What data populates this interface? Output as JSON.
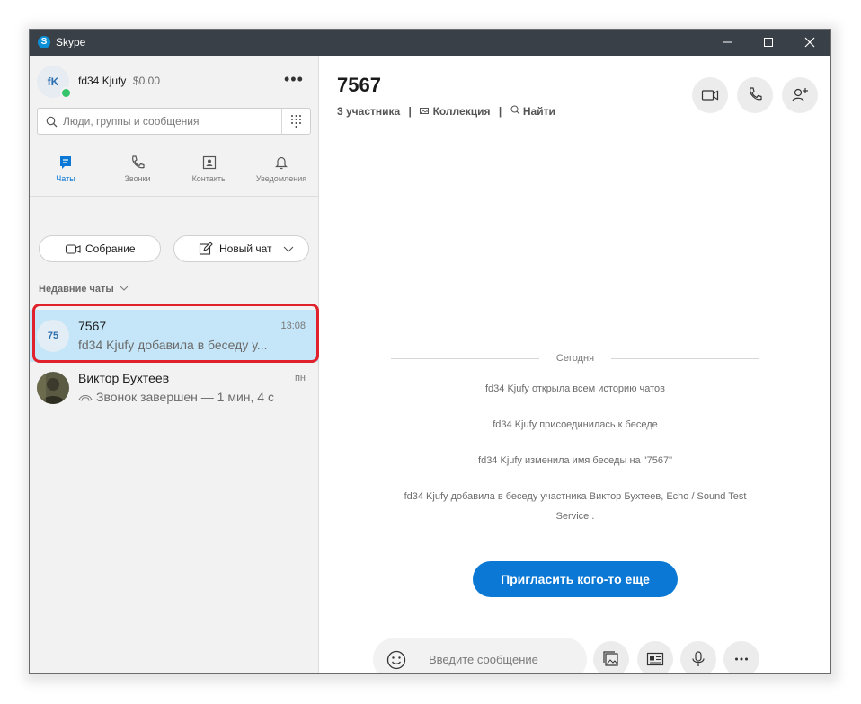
{
  "window": {
    "title": "Skype",
    "logo_letter": "S"
  },
  "profile": {
    "initials": "fK",
    "name": "fd34 Kjufy",
    "balance": "$0.00",
    "more": "•••"
  },
  "search": {
    "placeholder": "Люди, группы и сообщения"
  },
  "nav": [
    {
      "label": "Чаты",
      "icon": "chat-icon",
      "active": true
    },
    {
      "label": "Звонки",
      "icon": "phone-icon",
      "active": false
    },
    {
      "label": "Контакты",
      "icon": "contacts-icon",
      "active": false
    },
    {
      "label": "Уведомления",
      "icon": "bell-icon",
      "active": false
    }
  ],
  "actions": {
    "meeting": "Собрание",
    "new_chat": "Новый чат"
  },
  "recent": {
    "title": "Недавние чаты",
    "items": [
      {
        "initials": "75",
        "name": "7567",
        "time": "13:08",
        "preview": "fd34 Kjufy добавила в беседу у...",
        "active": true
      },
      {
        "name": "Виктор Бухтеев",
        "time": "пн",
        "preview": "Звонок завершен — 1 мин, 4 с",
        "active": false
      }
    ]
  },
  "conversation": {
    "title": "7567",
    "participants": "3 участника",
    "gallery": "Коллекция",
    "find": "Найти",
    "day": "Сегодня",
    "messages": [
      "fd34 Kjufy открыла всем историю чатов",
      "fd34 Kjufy присоединилась к беседе",
      "fd34 Kjufy изменила имя беседы на \"7567\"",
      "fd34 Kjufy добавила в беседу участника Виктор Бухтеев, Echo / Sound Test Service ."
    ],
    "invite": "Пригласить кого-то еще"
  },
  "composer": {
    "placeholder": "Введите сообщение"
  },
  "colors": {
    "accent": "#0a78d4",
    "titlebar": "#3a4048",
    "highlight": "#e0202a",
    "selected": "#c4e6f8"
  }
}
